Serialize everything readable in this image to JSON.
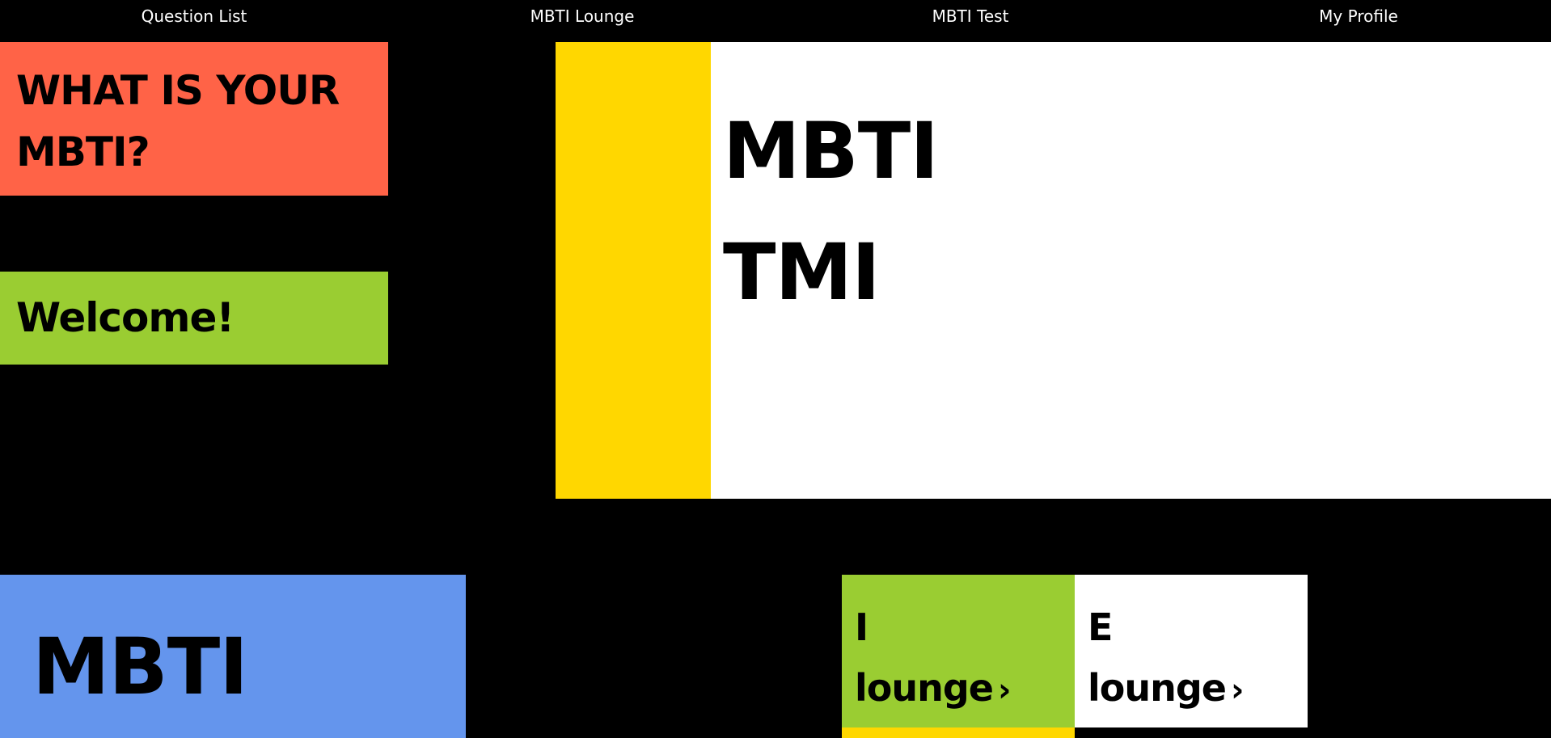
{
  "nav": {
    "items": [
      {
        "label": "Question List"
      },
      {
        "label": "MBTI Lounge"
      },
      {
        "label": "MBTI Test"
      },
      {
        "label": "My Profile"
      }
    ]
  },
  "hero": {
    "title_line1": "WHAT IS YOUR",
    "title_line2": "MBTI?",
    "welcome": "Welcome!"
  },
  "main": {
    "line1": "MBTI",
    "line2": "TMI"
  },
  "bottom": {
    "label": "MBTI"
  },
  "lounges": {
    "i": {
      "letter": "I",
      "word": "lounge",
      "chevron": "›"
    },
    "e": {
      "letter": "E",
      "word": "lounge",
      "chevron": "›"
    }
  },
  "colors": {
    "background": "#000000",
    "coral": "#FF6347",
    "green": "#9ACD32",
    "yellow": "#FFD700",
    "white": "#FFFFFF",
    "blue": "#6495ED"
  }
}
